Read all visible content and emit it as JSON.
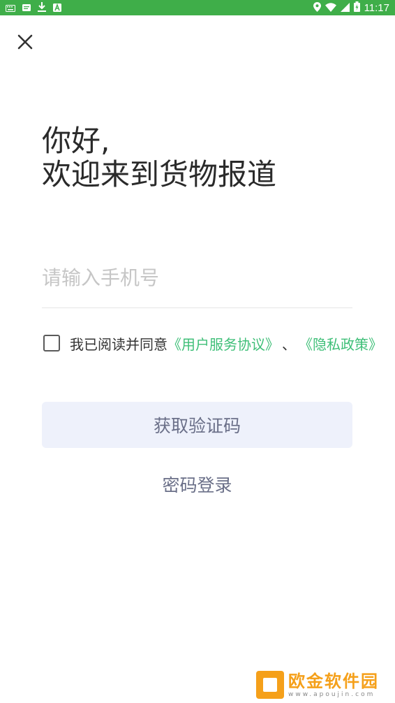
{
  "status_bar": {
    "time": "11:17",
    "background": "#3fae49",
    "left_icons": [
      "keyboard-icon",
      "sms-icon",
      "download-icon",
      "a-icon"
    ],
    "right_icons": [
      "location-icon",
      "wifi-icon",
      "signal-icon",
      "battery-icon"
    ]
  },
  "header": {
    "close_icon": "close-icon"
  },
  "greeting": {
    "line1": "你好,",
    "line2": "欢迎来到货物报道"
  },
  "phone": {
    "placeholder": "请输入手机号",
    "value": ""
  },
  "agreement": {
    "checked": false,
    "prefix": "我已阅读并同意",
    "terms_link": "《用户服务协议》",
    "separator": "、",
    "privacy_link": "《隐私政策》",
    "link_color": "#3fbf78"
  },
  "actions": {
    "get_code_label": "获取验证码",
    "password_login_label": "密码登录"
  },
  "watermark": {
    "title": "欧金软件园",
    "subtitle": "www.apoujin.com"
  }
}
